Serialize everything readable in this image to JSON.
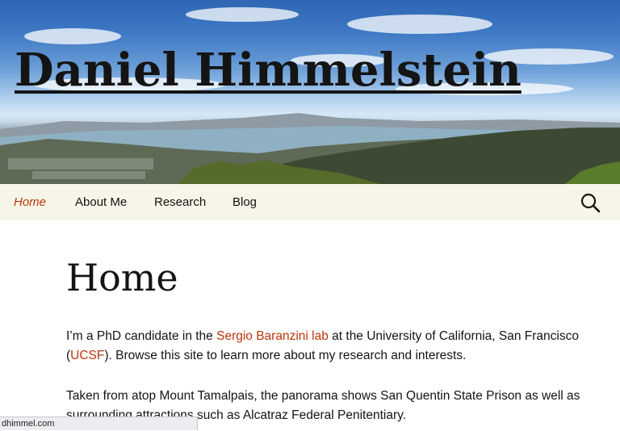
{
  "site": {
    "title": "Daniel Himmelstein"
  },
  "nav": {
    "items": [
      {
        "label": "Home",
        "active": true
      },
      {
        "label": "About Me",
        "active": false
      },
      {
        "label": "Research",
        "active": false
      },
      {
        "label": "Blog",
        "active": false
      }
    ],
    "search_icon": "search-icon"
  },
  "page": {
    "title": "Home",
    "p1": {
      "t1": "I’m a PhD candidate in the ",
      "link1": "Sergio Baranzini lab",
      "t2": " at the University of California, San Francisco (",
      "link2": "UCSF",
      "t3": "). Browse this site to learn more about my research and interests."
    },
    "p2": "Taken from atop Mount Tamalpais, the panorama shows San Quentin State Prison as well as surrounding attractions such as Alcatraz Federal Penitentiary."
  },
  "status_bar": {
    "url": "dhimmel.com"
  },
  "colors": {
    "accent": "#bc360a",
    "nav_bg": "#f7f5e7",
    "text": "#141412"
  }
}
